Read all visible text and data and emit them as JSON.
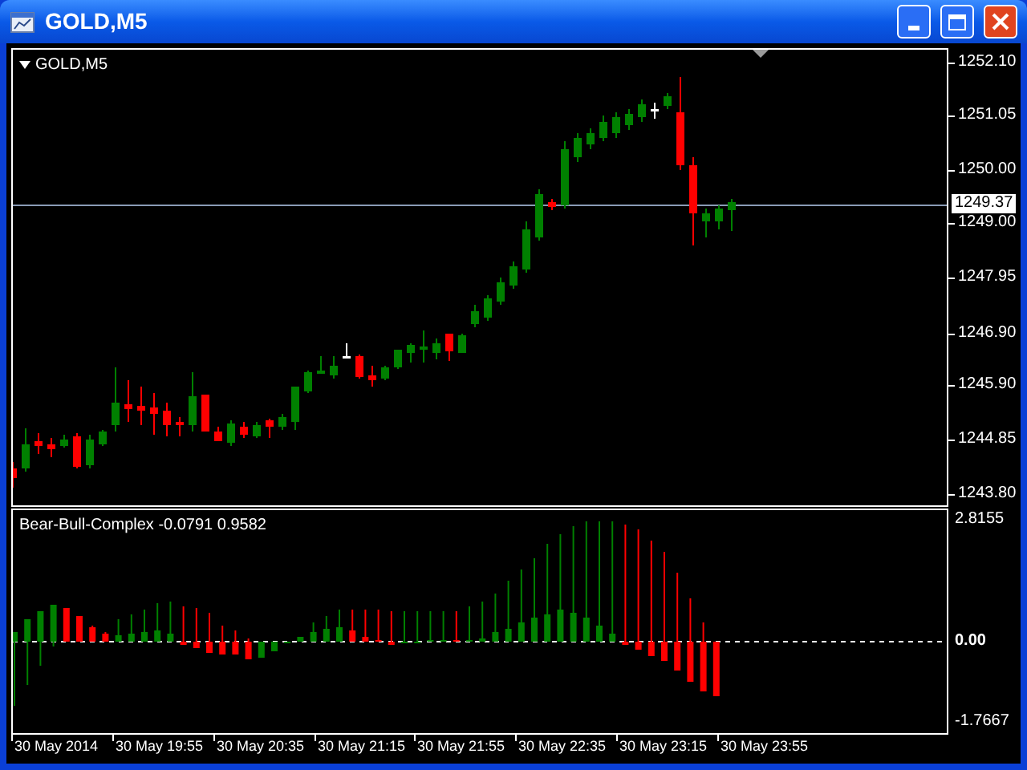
{
  "window": {
    "title": "GOLD,M5"
  },
  "chart": {
    "symbol_label": "GOLD,M5",
    "price_axis": [
      "1252.10",
      "1251.05",
      "1250.00",
      "1249.00",
      "1247.95",
      "1246.90",
      "1245.90",
      "1244.85",
      "1243.80"
    ],
    "current_price": "1249.37"
  },
  "indicator": {
    "label": "Bear-Bull-Complex -0.0791 0.9582",
    "axis": [
      "2.8155",
      "0.00",
      "-1.7667"
    ]
  },
  "time_axis": [
    "30 May 2014",
    "30 May 19:55",
    "30 May 20:35",
    "30 May 21:15",
    "30 May 21:55",
    "30 May 22:35",
    "30 May 23:15",
    "30 May 23:55"
  ]
}
